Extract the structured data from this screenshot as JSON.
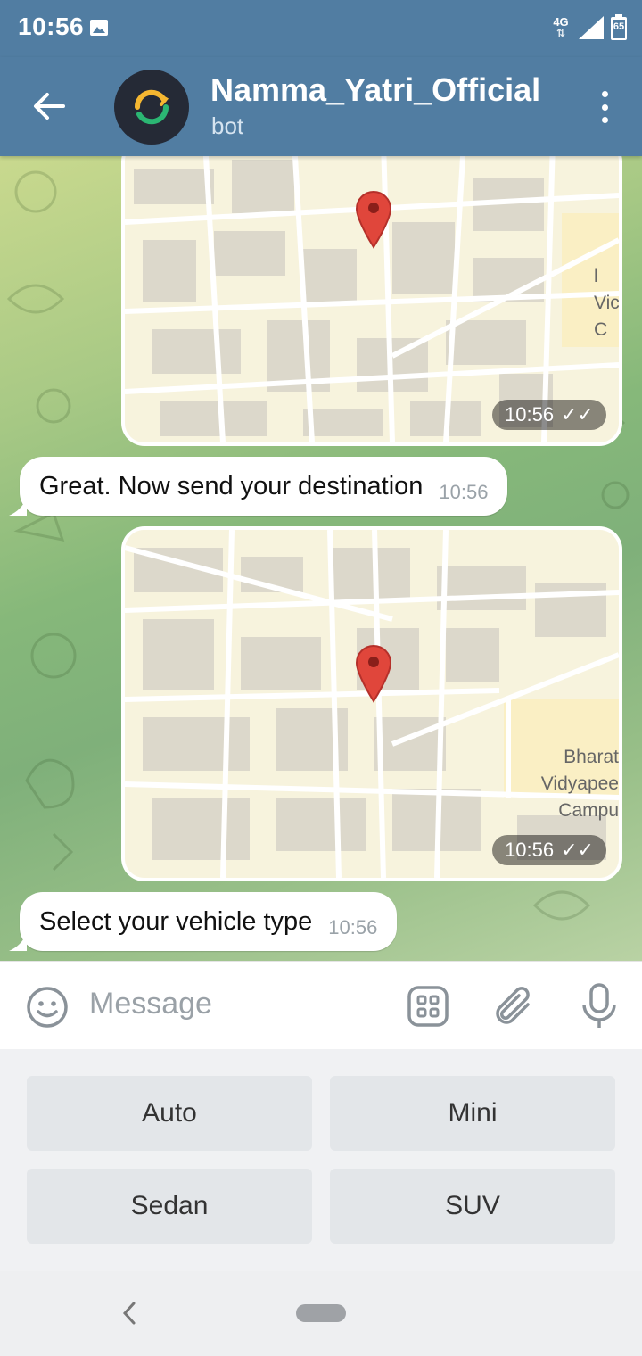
{
  "status_bar": {
    "time": "10:56",
    "network": "4G",
    "battery": "65"
  },
  "header": {
    "title": "Namma_Yatri_Official",
    "subtitle": "bot"
  },
  "messages": [
    {
      "type": "location",
      "time": "10:56",
      "labels": [
        "l",
        "Vic",
        "C"
      ]
    },
    {
      "type": "text",
      "text": "Great. Now send your destination",
      "time": "10:56"
    },
    {
      "type": "location",
      "time": "10:56",
      "labels": [
        "Bharat",
        "Vidyapee",
        "Campu"
      ]
    },
    {
      "type": "text",
      "text": "Select your vehicle type",
      "time": "10:56"
    }
  ],
  "composer": {
    "placeholder": "Message"
  },
  "keyboard": {
    "buttons": [
      "Auto",
      "Mini",
      "Sedan",
      "SUV"
    ]
  },
  "colors": {
    "header": "#517da2",
    "pin": "#e0463b",
    "map_bg": "#f7f3dd"
  }
}
